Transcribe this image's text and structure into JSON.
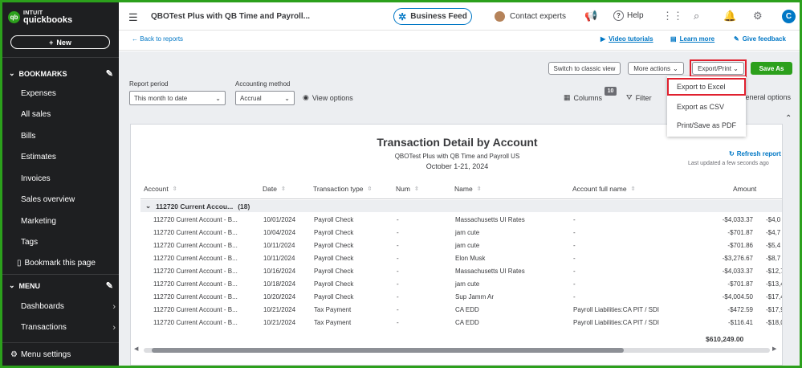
{
  "sidebar": {
    "logo_top": "INTUIT",
    "logo_bottom": "quickbooks",
    "logo_mark": "qb",
    "new_label": "New",
    "bookmarks_heading": "BOOKMARKS",
    "bookmark_items": [
      {
        "label": "Expenses"
      },
      {
        "label": "All sales"
      },
      {
        "label": "Bills"
      },
      {
        "label": "Estimates"
      },
      {
        "label": "Invoices"
      },
      {
        "label": "Sales overview"
      },
      {
        "label": "Marketing"
      },
      {
        "label": "Tags"
      }
    ],
    "bookmark_page": "Bookmark this page",
    "menu_heading": "MENU",
    "menu_items": [
      {
        "label": "Dashboards"
      },
      {
        "label": "Transactions"
      }
    ],
    "menu_settings": "Menu settings"
  },
  "topbar": {
    "company": "QBOTest Plus with QB Time and Payroll...",
    "business_feed": "Business Feed",
    "contact": "Contact experts",
    "help": "Help",
    "user_initial": "C"
  },
  "subhead": {
    "back": "Back to reports",
    "video": "Video tutorials",
    "learn": "Learn more",
    "feedback": "Give feedback"
  },
  "toolbar": {
    "classic": "Switch to classic view",
    "more": "More actions",
    "export": "Export/Print",
    "save": "Save As",
    "export_menu": [
      "Export to Excel",
      "Export as CSV",
      "Print/Save as PDF"
    ],
    "report_period_label": "Report period",
    "report_period_value": "This month to date",
    "accounting_label": "Accounting method",
    "accounting_value": "Accrual",
    "view_options": "View options",
    "columns": "Columns",
    "columns_count": "10",
    "filter": "Filter",
    "general": "General options"
  },
  "report": {
    "title": "Transaction Detail by Account",
    "company": "QBOTest Plus with QB Time and Payroll US",
    "dates": "October 1-21, 2024",
    "refresh": "Refresh report",
    "updated": "Last updated a few seconds ago",
    "headers": [
      "Account",
      "Date",
      "Transaction type",
      "Num",
      "Name",
      "Account full name",
      "Amount"
    ],
    "group": "112720 Current Accou...",
    "group_count": "(18)",
    "rows": [
      {
        "account": "112720 Current Account - B...",
        "date": "10/01/2024",
        "type": "Payroll Check",
        "num": "-",
        "name": "Massachusetts UI Rates",
        "full": "-",
        "amount": "-$4,033.37",
        "balance": "-$4,0"
      },
      {
        "account": "112720 Current Account - B...",
        "date": "10/04/2024",
        "type": "Payroll Check",
        "num": "-",
        "name": "jam cute",
        "full": "-",
        "amount": "-$701.87",
        "balance": "-$4,7"
      },
      {
        "account": "112720 Current Account - B...",
        "date": "10/11/2024",
        "type": "Payroll Check",
        "num": "-",
        "name": "jam cute",
        "full": "-",
        "amount": "-$701.86",
        "balance": "-$5,4"
      },
      {
        "account": "112720 Current Account - B...",
        "date": "10/11/2024",
        "type": "Payroll Check",
        "num": "-",
        "name": "Elon Musk",
        "full": "-",
        "amount": "-$3,276.67",
        "balance": "-$8,7"
      },
      {
        "account": "112720 Current Account - B...",
        "date": "10/16/2024",
        "type": "Payroll Check",
        "num": "-",
        "name": "Massachusetts UI Rates",
        "full": "-",
        "amount": "-$4,033.37",
        "balance": "-$12,7"
      },
      {
        "account": "112720 Current Account - B...",
        "date": "10/18/2024",
        "type": "Payroll Check",
        "num": "-",
        "name": "jam cute",
        "full": "-",
        "amount": "-$701.87",
        "balance": "-$13,4"
      },
      {
        "account": "112720 Current Account - B...",
        "date": "10/20/2024",
        "type": "Payroll Check",
        "num": "-",
        "name": "Sup Jamm Ar",
        "full": "-",
        "amount": "-$4,004.50",
        "balance": "-$17,4"
      },
      {
        "account": "112720 Current Account - B...",
        "date": "10/21/2024",
        "type": "Tax Payment",
        "num": "-",
        "name": "CA EDD",
        "full": "Payroll Liabilities:CA PIT / SDI",
        "amount": "-$472.59",
        "balance": "-$17,9"
      },
      {
        "account": "112720 Current Account - B...",
        "date": "10/21/2024",
        "type": "Tax Payment",
        "num": "-",
        "name": "CA EDD",
        "full": "Payroll Liabilities:CA PIT / SDI",
        "amount": "-$116.41",
        "balance": "-$18,0"
      }
    ],
    "total": "$610,249.00"
  },
  "colors": {
    "brand_green": "#2ca01c",
    "link_blue": "#0077c5",
    "highlight_red": "#e0212f",
    "sidebar_bg": "#1e1f21"
  }
}
